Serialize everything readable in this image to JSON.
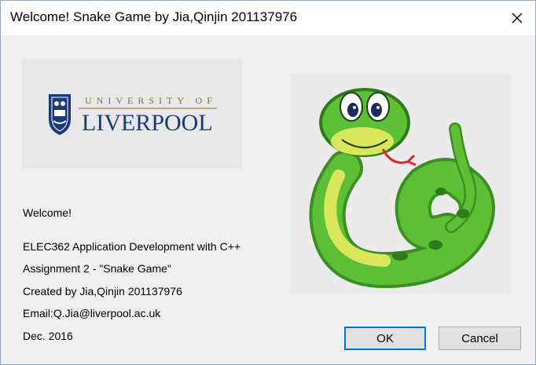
{
  "window": {
    "title": "Welcome! Snake Game by Jia,Qinjin 201137976",
    "close_icon": "close-icon"
  },
  "logo": {
    "line1": "UNIVERSITY OF",
    "line2": "LIVERPOOL",
    "brand_color": "#1a3a7a",
    "accent_color": "#8a6d2f"
  },
  "snake_image": {
    "icon": "cartoon-snake-icon",
    "body_color": "#4caf2e",
    "belly_color": "#d8e85a"
  },
  "info": {
    "welcome": "Welcome!",
    "course": "ELEC362 Application Development with C++",
    "assignment": "Assignment 2 - \"Snake Game\"",
    "author": "Created by Jia,Qinjin 201137976",
    "email": "Email:Q.Jia@liverpool.ac.uk",
    "date": "Dec. 2016"
  },
  "buttons": {
    "ok": "OK",
    "cancel": "Cancel",
    "ok_border_color": "#0078d7"
  }
}
